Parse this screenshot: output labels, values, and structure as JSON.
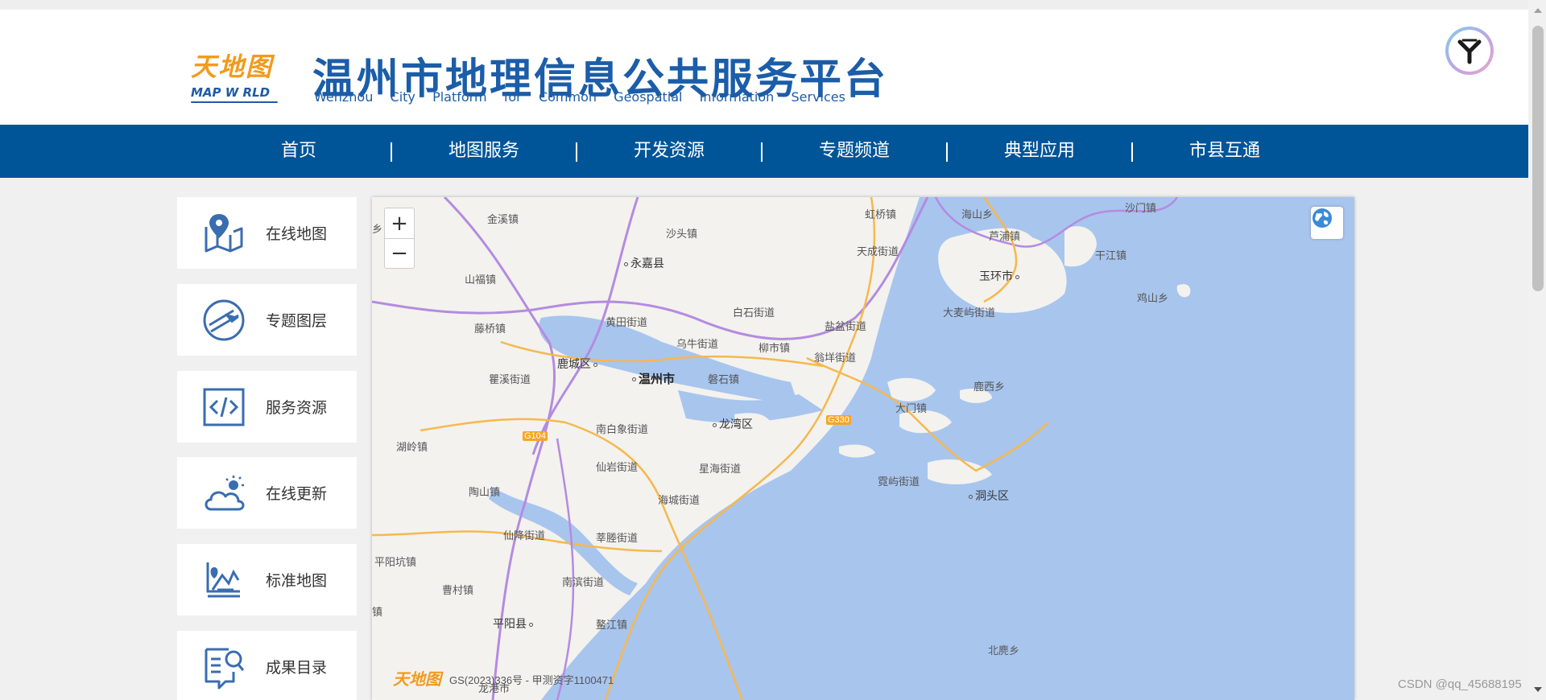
{
  "header": {
    "logo_cn": "天地图",
    "logo_en": "MAP W RLD",
    "title": "温州市地理信息公共服务平台",
    "subtitle_words": [
      "Wenzhou",
      "City",
      "Platform",
      "for",
      "Common",
      "Geospatial",
      "Information",
      "Services"
    ]
  },
  "nav": {
    "items": [
      {
        "label": "首页"
      },
      {
        "label": "地图服务"
      },
      {
        "label": "开发资源"
      },
      {
        "label": "专题频道"
      },
      {
        "label": "典型应用"
      },
      {
        "label": "市县互通"
      }
    ]
  },
  "sidebar": {
    "items": [
      {
        "label": "在线地图",
        "icon": "map-pin-icon"
      },
      {
        "label": "专题图层",
        "icon": "layers-icon"
      },
      {
        "label": "服务资源",
        "icon": "code-icon"
      },
      {
        "label": "在线更新",
        "icon": "cloud-update-icon"
      },
      {
        "label": "标准地图",
        "icon": "standard-map-icon"
      },
      {
        "label": "成果目录",
        "icon": "catalog-search-icon"
      }
    ]
  },
  "map": {
    "zoom_in": "+",
    "zoom_out": "−",
    "logo": "天地图",
    "copyright": "GS(2023)336号 - 甲测资字1100471",
    "places": {
      "jinxi": "金溪镇",
      "shatou": "沙头镇",
      "qiaotou": "虹桥镇",
      "haishan": "海山乡",
      "shamen": "沙门镇",
      "xiang": "乡",
      "yongjia": "永嘉县",
      "tiancheng": "天成街道",
      "pucheng": "芦浦镇",
      "ganjiang": "干江镇",
      "shanfu": "山福镇",
      "yuhuan": "玉环市",
      "jishan": "鸡山乡",
      "huangtian": "黄田街道",
      "baishi": "白石街道",
      "yanpen": "盐盆街道",
      "damaiyu": "大麦屿街道",
      "tengqiao": "藤桥镇",
      "wuniu": "乌牛街道",
      "liushi": "柳市镇",
      "wengyang": "翁垟街道",
      "luchengqu": "鹿城区",
      "wenzhou": "温州市",
      "quxi": "瞿溪街道",
      "panshi": "磐石镇",
      "luxi": "鹿西乡",
      "damen": "大门镇",
      "nanbaixiang": "南白象街道",
      "longwan": "龙湾区",
      "huling": "湖岭镇",
      "xianyan": "仙岩街道",
      "xinghai": "星海街道",
      "xiaoyu": "霓屿街道",
      "dongtou": "洞头区",
      "taoshan": "陶山镇",
      "haicheng": "海城街道",
      "xianjiang": "仙降街道",
      "xinchan": "莘塍街道",
      "pingyangkeng": "平阳坑镇",
      "nanbin": "南滨街道",
      "caocun": "曹村镇",
      "pingyang": "平阳县",
      "aijiang": "鳌江镇",
      "beiji": "北麂乡",
      "longgang": "龙港市",
      "zhen": "镇"
    },
    "roads": [
      "G104",
      "G330"
    ]
  },
  "watermark": "CSDN @qq_45688195",
  "colors": {
    "brand_blue": "#005599",
    "title_blue": "#1b5da8",
    "logo_orange": "#f29a1d",
    "sea": "#a8c5ee",
    "land": "#f3f2ee"
  }
}
